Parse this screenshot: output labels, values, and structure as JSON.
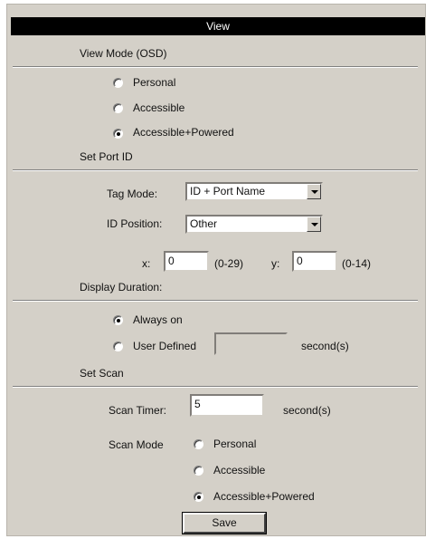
{
  "window": {
    "title": "View"
  },
  "view_mode": {
    "heading": "View Mode (OSD)",
    "options": [
      {
        "label": "Personal",
        "checked": false
      },
      {
        "label": "Accessible",
        "checked": false
      },
      {
        "label": "Accessible+Powered",
        "checked": true
      }
    ]
  },
  "port_id": {
    "heading": "Set Port ID",
    "tag_mode_label": "Tag Mode:",
    "tag_mode_value": "ID + Port Name",
    "id_position_label": "ID Position:",
    "id_position_value": "Other",
    "x_label": "x:",
    "x_value": "0",
    "x_range": "(0-29)",
    "y_label": "y:",
    "y_value": "0",
    "y_range": "(0-14)"
  },
  "display_duration": {
    "heading": "Display Duration:",
    "always_on_label": "Always on",
    "always_on_checked": true,
    "user_defined_label": "User Defined",
    "user_defined_checked": false,
    "user_defined_value": "",
    "unit": "second(s)"
  },
  "scan": {
    "heading": "Set Scan",
    "timer_label": "Scan Timer:",
    "timer_value": "5",
    "timer_unit": "second(s)",
    "mode_label": "Scan Mode",
    "options": [
      {
        "label": "Personal",
        "checked": false
      },
      {
        "label": "Accessible",
        "checked": false
      },
      {
        "label": "Accessible+Powered",
        "checked": true
      }
    ]
  },
  "actions": {
    "save_label": "Save"
  }
}
